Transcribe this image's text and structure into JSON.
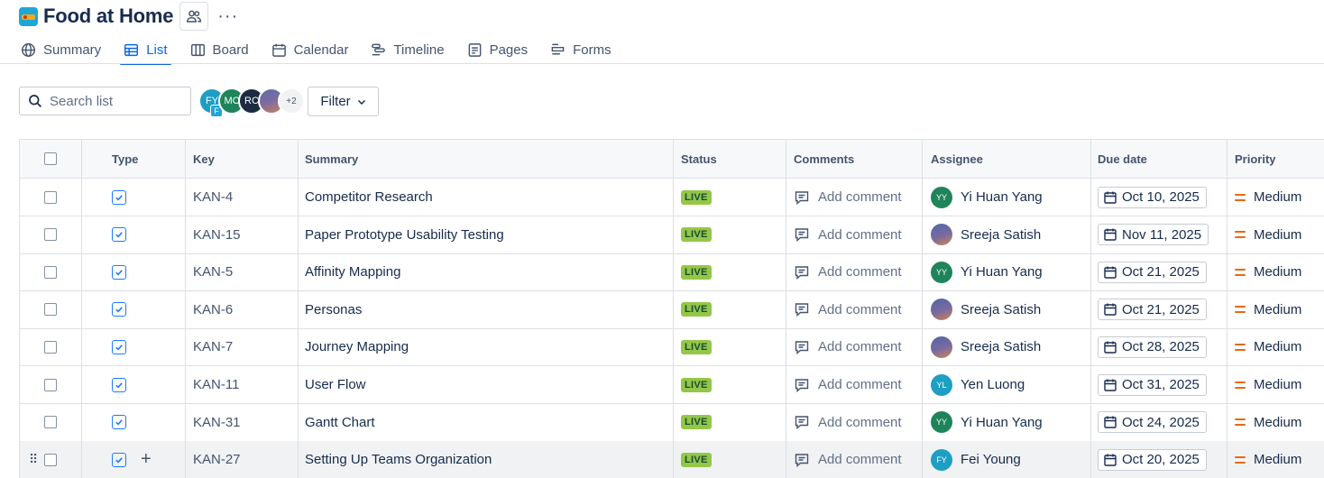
{
  "project": {
    "title": "Food at Home"
  },
  "tabs": [
    {
      "label": "Summary",
      "icon": "globe-icon"
    },
    {
      "label": "List",
      "icon": "list-icon",
      "active": true
    },
    {
      "label": "Board",
      "icon": "board-icon"
    },
    {
      "label": "Calendar",
      "icon": "calendar-icon"
    },
    {
      "label": "Timeline",
      "icon": "timeline-icon"
    },
    {
      "label": "Pages",
      "icon": "pages-icon"
    },
    {
      "label": "Forms",
      "icon": "forms-icon"
    }
  ],
  "toolbar": {
    "search_placeholder": "Search list",
    "filter_label": "Filter",
    "avatars": [
      {
        "initials": "FY",
        "sub": "F"
      },
      {
        "initials": "MC"
      },
      {
        "initials": "RC"
      },
      {
        "initials": ""
      },
      {
        "initials": "+2"
      }
    ]
  },
  "columns": [
    "Type",
    "Key",
    "Summary",
    "Status",
    "Comments",
    "Assignee",
    "Due date",
    "Priority"
  ],
  "rows": [
    {
      "key": "KAN-4",
      "summary": "Competitor Research",
      "status": "LIVE",
      "comment": "Add comment",
      "assignee": "Yi Huan Yang",
      "initials": "YY",
      "due": "Oct 10, 2025",
      "priority": "Medium"
    },
    {
      "key": "KAN-15",
      "summary": "Paper Prototype Usability Testing",
      "status": "LIVE",
      "comment": "Add comment",
      "assignee": "Sreeja Satish",
      "initials": "",
      "due": "Nov 11, 2025",
      "priority": "Medium"
    },
    {
      "key": "KAN-5",
      "summary": "Affinity Mapping",
      "status": "LIVE",
      "comment": "Add comment",
      "assignee": "Yi Huan Yang",
      "initials": "YY",
      "due": "Oct 21, 2025",
      "priority": "Medium"
    },
    {
      "key": "KAN-6",
      "summary": "Personas",
      "status": "LIVE",
      "comment": "Add comment",
      "assignee": "Sreeja Satish",
      "initials": "",
      "due": "Oct 21, 2025",
      "priority": "Medium"
    },
    {
      "key": "KAN-7",
      "summary": "Journey Mapping",
      "status": "LIVE",
      "comment": "Add comment",
      "assignee": "Sreeja Satish",
      "initials": "",
      "due": "Oct 28, 2025",
      "priority": "Medium"
    },
    {
      "key": "KAN-11",
      "summary": "User Flow",
      "status": "LIVE",
      "comment": "Add comment",
      "assignee": "Yen Luong",
      "initials": "YL",
      "due": "Oct 31, 2025",
      "priority": "Medium"
    },
    {
      "key": "KAN-31",
      "summary": "Gantt Chart",
      "status": "LIVE",
      "comment": "Add comment",
      "assignee": "Yi Huan Yang",
      "initials": "YY",
      "due": "Oct 24, 2025",
      "priority": "Medium"
    },
    {
      "key": "KAN-27",
      "summary": "Setting Up Teams Organization",
      "status": "LIVE",
      "comment": "Add comment",
      "assignee": "Fei Young",
      "initials": "FY",
      "due": "Oct 20, 2025",
      "priority": "Medium"
    }
  ]
}
